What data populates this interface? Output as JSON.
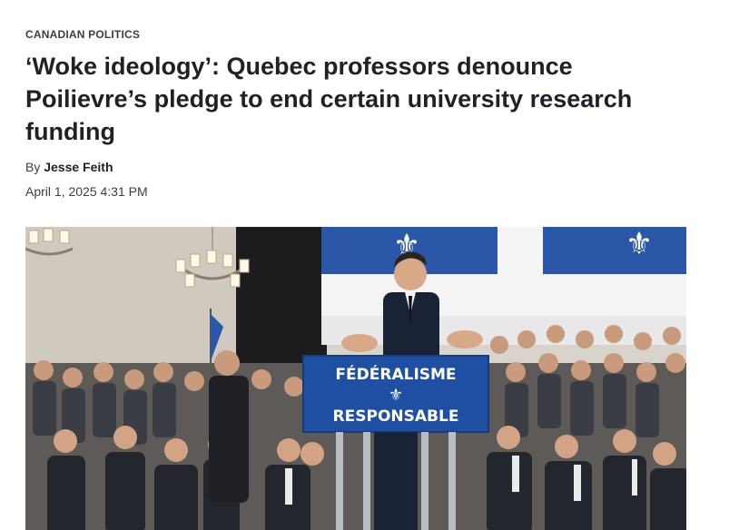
{
  "article": {
    "section": "CANADIAN POLITICS",
    "headline": "‘Woke ideology’: Quebec professors denounce Poilievre’s pledge to end certain university research funding",
    "byline_prefix": "By",
    "author": "Jesse Feith",
    "published": "April 1, 2025 4:31 PM"
  },
  "photo": {
    "podium_sign_line1": "FÉDÉRALISME",
    "podium_sign_line2": "RESPONSABLE",
    "flag_symbol": "fleur-de-lis",
    "colors": {
      "flag_blue": "#2a57a8",
      "podium_blue": "#1e4fa3"
    }
  }
}
